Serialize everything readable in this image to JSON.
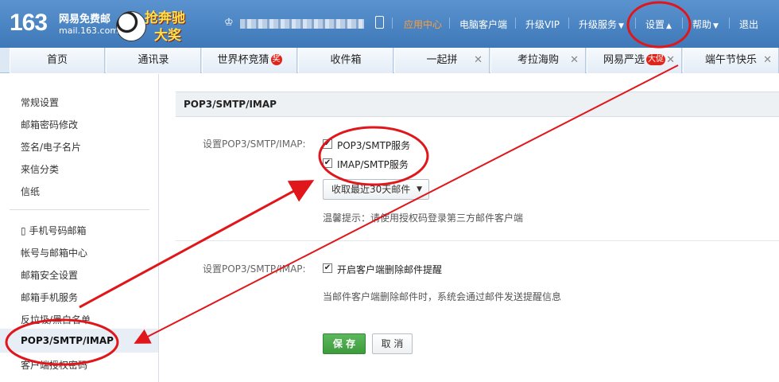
{
  "header": {
    "logo_number": "163",
    "logo_cn": "网易免费邮",
    "logo_domain": "mail.163.com",
    "promo_line1": "抢奔驰",
    "promo_line2": "大奖",
    "nav": {
      "app_center": "应用中心",
      "pc_client": "电脑客户端",
      "vip": "升级VIP",
      "upgrade_service": "升级服务",
      "settings": "设置",
      "help": "帮助",
      "logout": "退出"
    }
  },
  "tabs": [
    {
      "label": "首页"
    },
    {
      "label": "通讯录"
    },
    {
      "label": "世界杯竞猜",
      "badge": "奖"
    },
    {
      "label": "收件箱"
    },
    {
      "label": "一起拼"
    },
    {
      "label": "考拉海购"
    },
    {
      "label": "网易严选",
      "badge": "大促"
    },
    {
      "label": "端午节快乐"
    }
  ],
  "sidebar": {
    "group1": [
      "常规设置",
      "邮箱密码修改",
      "签名/电子名片",
      "来信分类",
      "信纸"
    ],
    "group2": [
      "手机号码邮箱",
      "帐号与邮箱中心",
      "邮箱安全设置",
      "邮箱手机服务",
      "反垃圾/黑白名单",
      "POP3/SMTP/IMAP",
      "客户端授权密码"
    ]
  },
  "main": {
    "section_title": "POP3/SMTP/IMAP",
    "row1_label": "设置POP3/SMTP/IMAP:",
    "opt_pop3": "POP3/SMTP服务",
    "opt_imap": "IMAP/SMTP服务",
    "dropdown_value": "收取最近30天邮件",
    "hint1": "温馨提示：请使用授权码登录第三方邮件客户端",
    "row2_label": "设置POP3/SMTP/IMAP:",
    "opt_delete_notice": "开启客户端删除邮件提醒",
    "hint2": "当邮件客户端删除邮件时，系统会通过邮件发送提醒信息",
    "save_label": "保 存",
    "cancel_label": "取 消"
  },
  "colors": {
    "header_blue": "#4a85c4",
    "accent_orange": "#ff9d3a",
    "save_green": "#4caf50",
    "annotation_red": "#e0161b"
  }
}
